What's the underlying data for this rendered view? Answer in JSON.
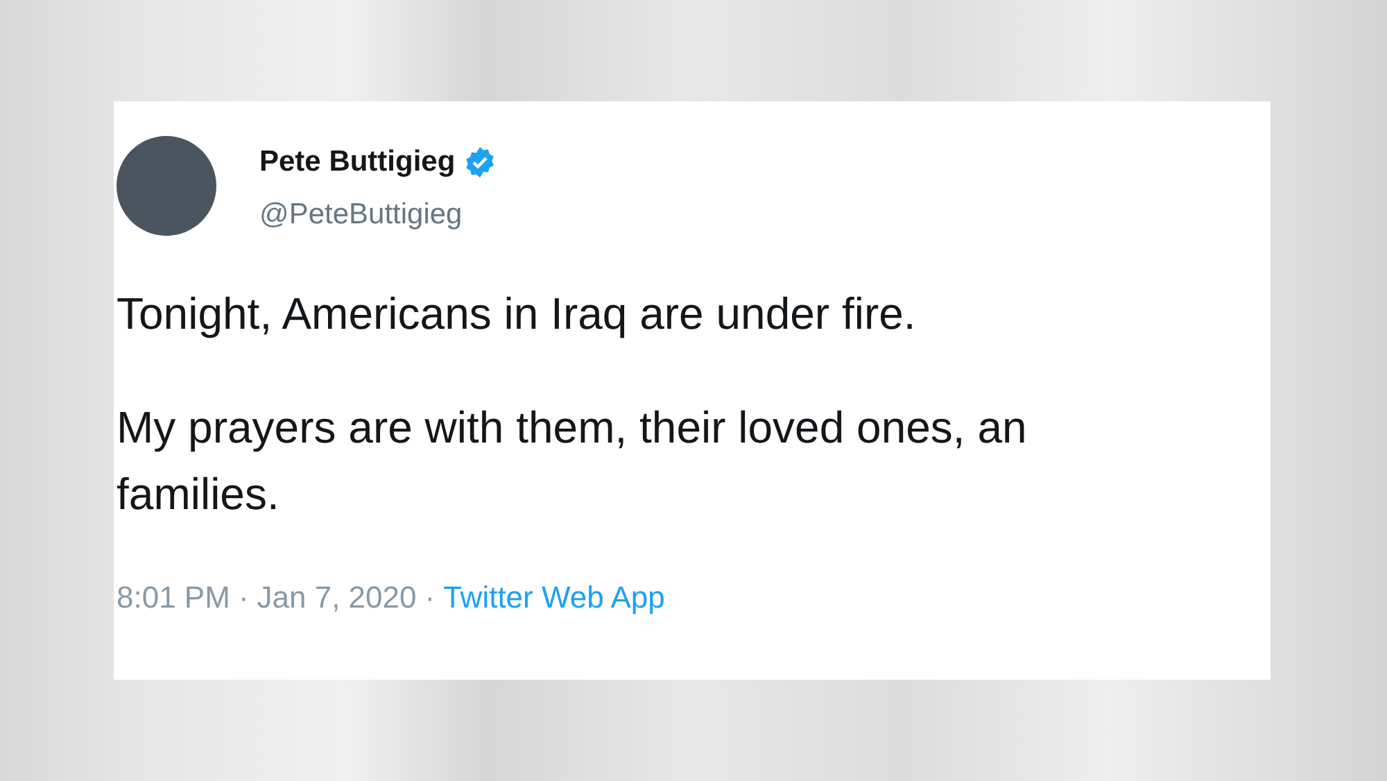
{
  "tweet": {
    "author": {
      "name": "Pete Buttigieg",
      "handle": "@PeteButtigieg",
      "verified": true
    },
    "paragraphs": [
      {
        "lines": [
          "Tonight, Americans in Iraq are under fire."
        ]
      },
      {
        "lines": [
          "My prayers are with them, their loved ones, an",
          "families."
        ]
      }
    ],
    "meta": {
      "time": "8:01 PM",
      "separator_1": "·",
      "date": "Jan 7, 2020",
      "separator_2": "·",
      "source": "Twitter Web App"
    }
  }
}
